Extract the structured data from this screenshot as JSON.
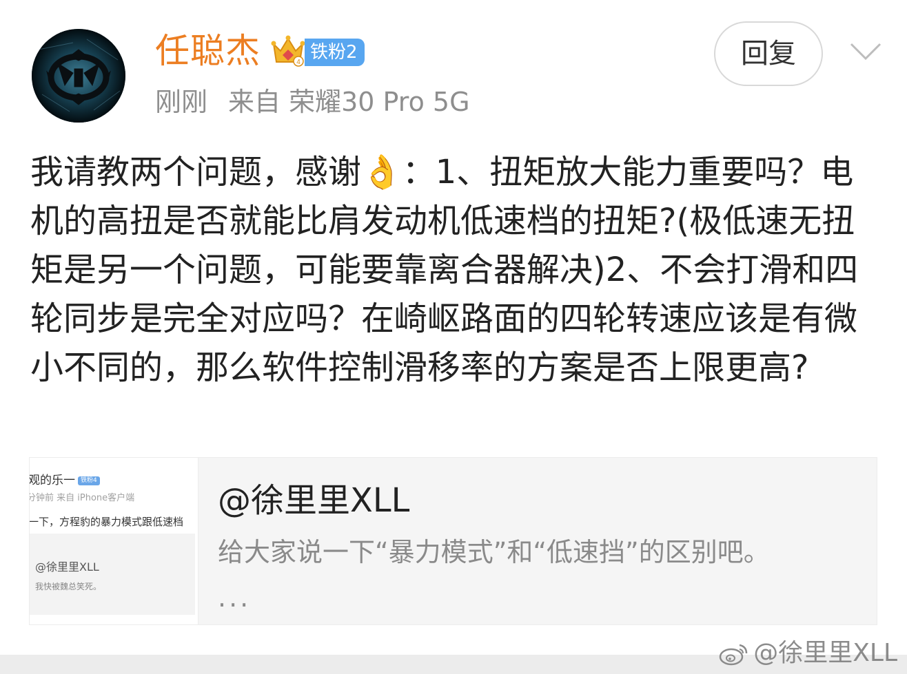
{
  "post": {
    "author": {
      "name": "任聪杰",
      "badge_label": "铁粉2",
      "crown_level": "4"
    },
    "time": "刚刚",
    "source": "来自 荣耀30 Pro 5G",
    "reply_label": "回复",
    "body": "我请教两个问题，感谢👌：1、扭矩放大能力重要吗？电机的高扭是否就能比肩发动机低速档的扭矩?(极低速无扭矩是另一个问题，可能要靠离合器解决)2、不会打滑和四轮同步是完全对应吗？在崎岖路面的四轮转速应该是有微小不同的，那么软件控制滑移率的方案是否上限更高?"
  },
  "shared_card": {
    "title": "@徐里里XLL",
    "description": "给大家说一下“暴力模式”和“低速挡”的区别吧。",
    "ellipsis": "...",
    "thumbnail": {
      "user_line": "观的乐一",
      "badge": "铁粉4",
      "time_line": "分钟前   来自 iPhone客户端",
      "text_line": "一下，方程豹的暴力模式跟低速档",
      "quote_name": "@徐里里XLL",
      "quote_text": "我快被魏总笑死。"
    }
  },
  "watermark": {
    "text": "@徐里里XLL",
    "icon": "weibo-logo-icon"
  },
  "colors": {
    "username": "#ec7e22",
    "badge": "#58a6f0",
    "meta": "#8e8e8e",
    "card_bg": "#f5f5f5"
  }
}
